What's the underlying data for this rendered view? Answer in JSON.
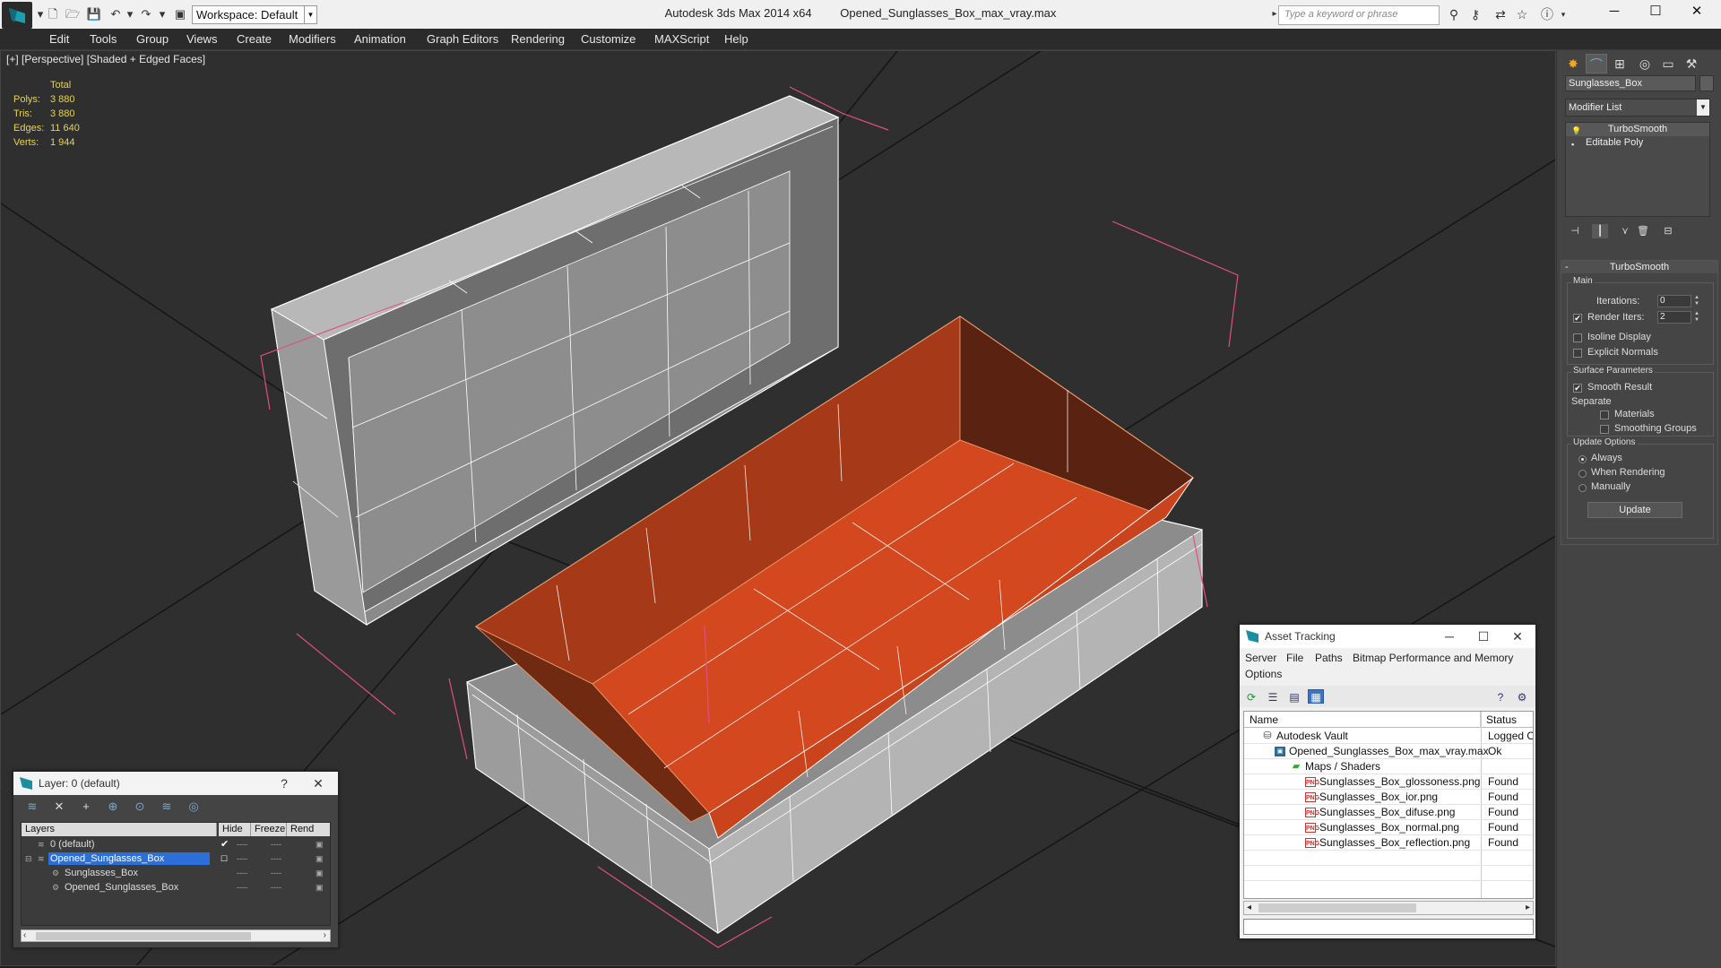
{
  "titlebar": {
    "app_title": "Autodesk 3ds Max  2014 x64",
    "file_title": "Opened_Sunglasses_Box_max_vray.max",
    "workspace_label": "Workspace: Default",
    "search_placeholder": "Type a keyword or phrase"
  },
  "menu": [
    "Edit",
    "Tools",
    "Group",
    "Views",
    "Create",
    "Modifiers",
    "Animation",
    "Graph Editors",
    "Rendering",
    "Customize",
    "MAXScript",
    "Help"
  ],
  "viewport": {
    "label": "[+] [Perspective] [Shaded + Edged Faces]",
    "stats": {
      "header": "Total",
      "rows": [
        {
          "k": "Polys:",
          "v": "3 880"
        },
        {
          "k": "Tris:",
          "v": "3 880"
        },
        {
          "k": "Edges:",
          "v": "11 640"
        },
        {
          "k": "Verts:",
          "v": "1 944"
        }
      ]
    }
  },
  "command_panel": {
    "object_name": "Sunglasses_Box",
    "modifier_list": "Modifier List",
    "stack": [
      "TurboSmooth",
      "Editable Poly"
    ],
    "rollout_title": "TurboSmooth",
    "main_group": "Main",
    "iterations_label": "Iterations:",
    "iterations_value": "0",
    "render_iters_label": "Render Iters:",
    "render_iters_value": "2",
    "isoline_label": "Isoline Display",
    "explicit_normals_label": "Explicit Normals",
    "surface_group": "Surface Parameters",
    "smooth_result_label": "Smooth Result",
    "separate_label": "Separate",
    "materials_label": "Materials",
    "smoothing_groups_label": "Smoothing Groups",
    "update_group": "Update Options",
    "always_label": "Always",
    "when_rendering_label": "When Rendering",
    "manually_label": "Manually",
    "update_button": "Update"
  },
  "layer_window": {
    "title": "Layer: 0 (default)",
    "help": "?",
    "columns": [
      "Layers",
      "Hide",
      "Freeze",
      "Rend"
    ],
    "rows": [
      {
        "name": "0 (default)"
      },
      {
        "name": "Opened_Sunglasses_Box"
      },
      {
        "name": "Sunglasses_Box"
      },
      {
        "name": "Opened_Sunglasses_Box"
      }
    ]
  },
  "asset_window": {
    "title": "Asset Tracking",
    "menu": [
      "Server",
      "File",
      "Paths",
      "Bitmap Performance and Memory",
      "Options"
    ],
    "columns": [
      "Name",
      "Status"
    ],
    "rows": [
      {
        "name": "Autodesk Vault",
        "status": "Logged O"
      },
      {
        "name": "Opened_Sunglasses_Box_max_vray.max",
        "status": "Ok"
      },
      {
        "name": "Maps / Shaders",
        "status": ""
      },
      {
        "name": "Sunglasses_Box_glossoness.png",
        "status": "Found"
      },
      {
        "name": "Sunglasses_Box_ior.png",
        "status": "Found"
      },
      {
        "name": "Sunglasses_Box_difuse.png",
        "status": "Found"
      },
      {
        "name": "Sunglasses_Box_normal.png",
        "status": "Found"
      },
      {
        "name": "Sunglasses_Box_reflection.png",
        "status": "Found"
      }
    ],
    "png_badge": "PNG"
  },
  "colors": {
    "selection_orange": "#c8461f",
    "wire_white": "#ffffff",
    "highlight_pink": "#e0507a",
    "stats_yellow": "#e8d44d",
    "layer_selected": "#2d6fd9"
  }
}
